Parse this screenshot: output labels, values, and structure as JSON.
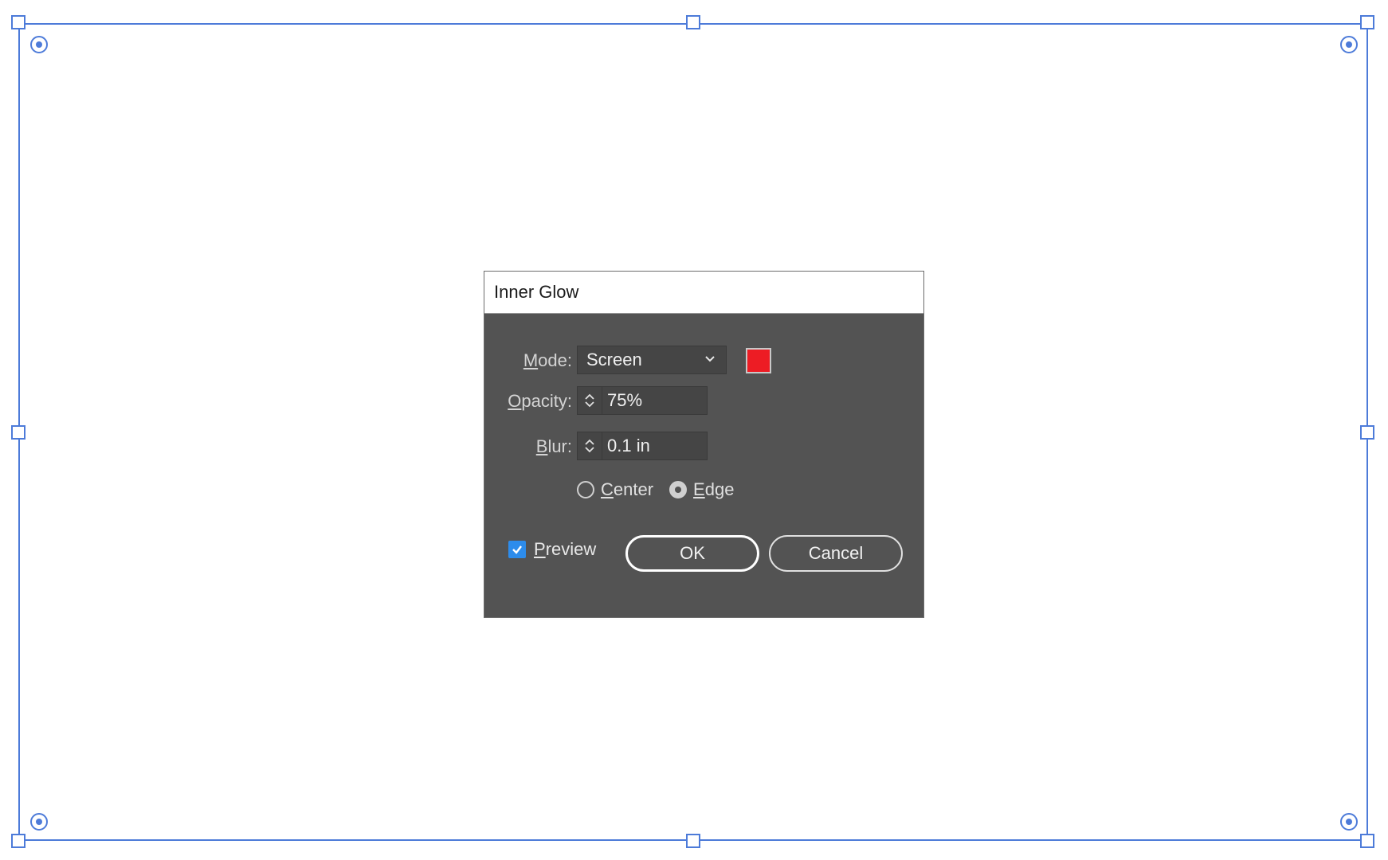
{
  "dialog": {
    "title": "Inner Glow",
    "mode": {
      "label_mnemonic": "M",
      "label_rest": "ode:",
      "value": "Screen",
      "swatch_color": "#ed1c24"
    },
    "opacity": {
      "label_mnemonic": "O",
      "label_rest": "pacity:",
      "value": "75%"
    },
    "blur": {
      "label_mnemonic": "B",
      "label_rest": "lur:",
      "value": "0.1 in"
    },
    "source": {
      "center_mnemonic": "C",
      "center_rest": "enter",
      "edge_mnemonic": "E",
      "edge_rest": "dge",
      "selected": "Edge"
    },
    "preview": {
      "mnemonic": "P",
      "rest": "review",
      "checked": true
    },
    "ok_label": "OK",
    "cancel_label": "Cancel"
  },
  "colors": {
    "selection": "#4d7bd9",
    "dialog_bg": "#535353",
    "checkbox": "#2d8ceb"
  }
}
